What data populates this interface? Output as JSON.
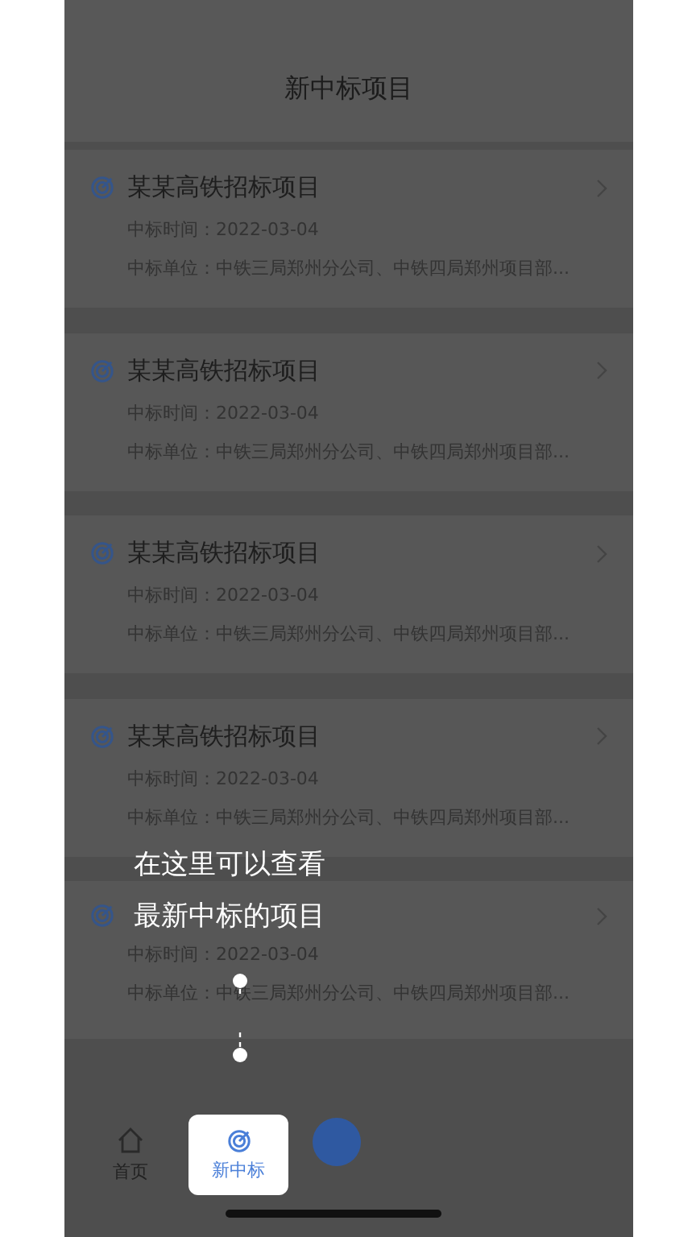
{
  "header": {
    "title": "新中标项目"
  },
  "cards": [
    {
      "title": "某某高铁招标项目",
      "time_label": "中标时间：",
      "time": "2022-03-04",
      "unit_label": "中标单位：",
      "unit": "中铁三局郑州分公司、中铁四局郑州项目部..."
    },
    {
      "title": "某某高铁招标项目",
      "time_label": "中标时间：",
      "time": "2022-03-04",
      "unit_label": "中标单位：",
      "unit": "中铁三局郑州分公司、中铁四局郑州项目部..."
    },
    {
      "title": "某某高铁招标项目",
      "time_label": "中标时间：",
      "time": "2022-03-04",
      "unit_label": "中标单位：",
      "unit": "中铁三局郑州分公司、中铁四局郑州项目部..."
    },
    {
      "title": "某某高铁招标项目",
      "time_label": "中标时间：",
      "time": "2022-03-04",
      "unit_label": "中标单位：",
      "unit": "中铁三局郑州分公司、中铁四局郑州项目部..."
    },
    {
      "time_label": "中标时间：",
      "time": "2022-03-04",
      "unit_label": "中标单位：",
      "unit": "中铁三局郑州分公司、中铁四局郑州项目部..."
    }
  ],
  "tooltip": {
    "lines": [
      "在这里可以查看",
      "最新中标的项目"
    ]
  },
  "tabs": [
    {
      "kind": "home",
      "label": "首页",
      "selected": false
    },
    {
      "kind": "target",
      "label": "新中标",
      "selected": true
    },
    {
      "kind": "plus",
      "selected": false
    }
  ]
}
